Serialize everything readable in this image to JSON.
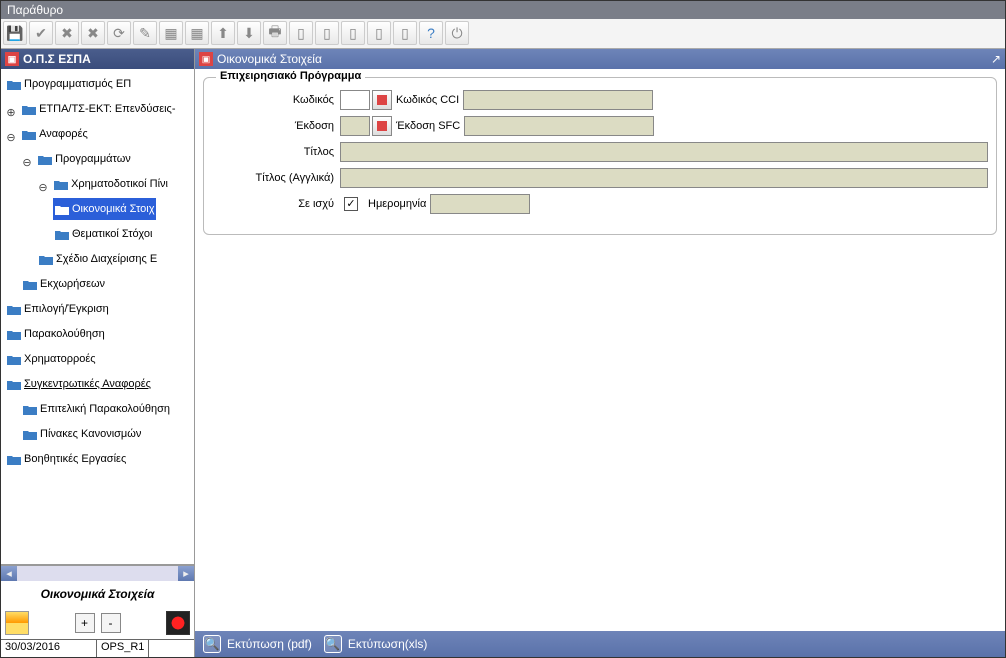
{
  "window_title": "Παράθυρο",
  "sidebar": {
    "title": "Ο.Π.Σ ΕΣΠΑ",
    "caption": "Οικονομικά Στοιχεία",
    "plus": "+",
    "minus": "-",
    "items": [
      {
        "label": "Προγραμματισμός ΕΠ"
      },
      {
        "label": "ΕΤΠΑ/ΤΣ-ΕΚΤ: Επενδύσεις-"
      },
      {
        "label": "Αναφορές"
      },
      {
        "label": "Προγραμμάτων"
      },
      {
        "label": "Χρηματοδοτικοί Πίνι"
      },
      {
        "label": "Οικονομικά Στοιχ"
      },
      {
        "label": "Θεματικοί Στόχοι"
      },
      {
        "label": "Σχέδιο Διαχείρισης Ε"
      },
      {
        "label": "Εκχωρήσεων"
      },
      {
        "label": "Επιλογή/Έγκριση"
      },
      {
        "label": "Παρακολούθηση"
      },
      {
        "label": "Χρηματορροές"
      },
      {
        "label": "Συγκεντρωτικές Αναφορές"
      },
      {
        "label": "Επιτελική Παρακολούθηση"
      },
      {
        "label": "Πίνακες Κανονισμών"
      },
      {
        "label": "Βοηθητικές Εργασίες"
      }
    ]
  },
  "panel": {
    "title": "Οικονομικά Στοιχεία",
    "group_title": "Επιχειρησιακό Πρόγραμμα",
    "labels": {
      "code": "Κωδικός",
      "code_cci": "Κωδικός CCI",
      "version": "Έκδοση",
      "version_sfc": "Έκδοση SFC",
      "title": "Τίτλος",
      "title_en": "Τίτλος (Αγγλικά)",
      "active": "Σε ισχύ",
      "date": "Ημερομηνία"
    },
    "values": {
      "code": "",
      "code_cci": "",
      "version": "",
      "version_sfc": "",
      "title": "",
      "title_en": "",
      "active": true,
      "date": ""
    }
  },
  "bottombar": {
    "print_pdf": "Εκτύπωση (pdf)",
    "print_xls": "Εκτύπωση(xls)"
  },
  "status": {
    "date": "30/03/2016",
    "user": "OPS_R1"
  }
}
